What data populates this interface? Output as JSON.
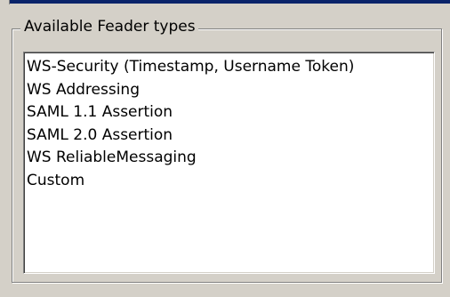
{
  "groupbox": {
    "title": "Available Feader types"
  },
  "header_types": {
    "items": [
      {
        "label": "WS-Security (Timestamp, Username Token)"
      },
      {
        "label": "WS Addressing"
      },
      {
        "label": "SAML 1.1 Assertion"
      },
      {
        "label": "SAML 2.0 Assertion"
      },
      {
        "label": "WS ReliableMessaging"
      },
      {
        "label": "Custom"
      }
    ]
  },
  "colors": {
    "window_background": "#d4d0c8",
    "list_background": "#ffffff",
    "title_bar_accent": "#0a246a",
    "text": "#000000"
  }
}
